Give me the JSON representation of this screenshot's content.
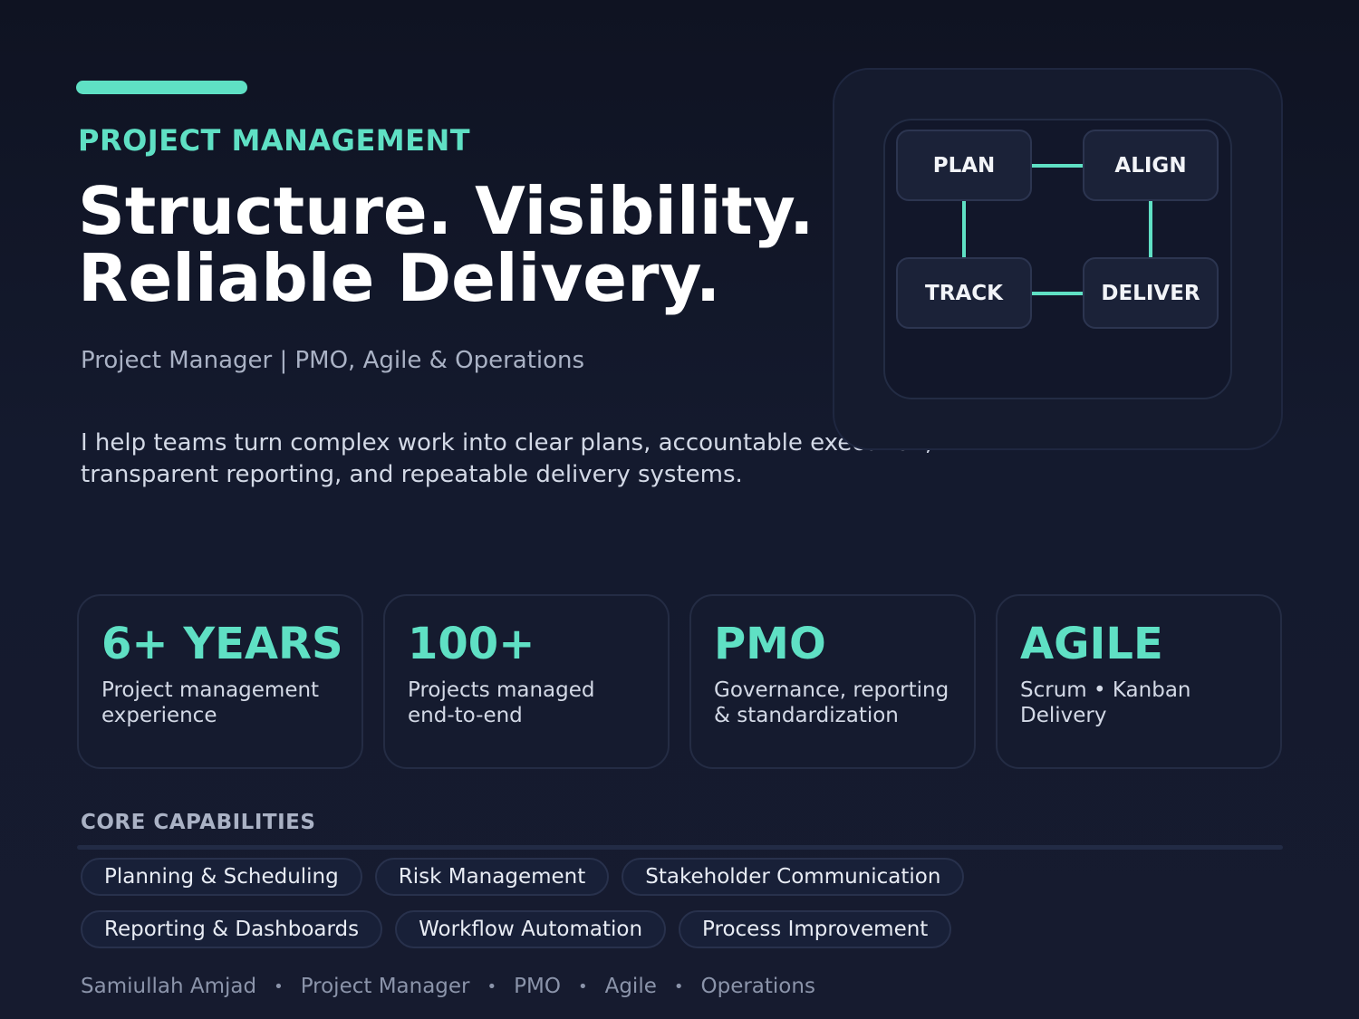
{
  "hero": {
    "eyebrow": "PROJECT MANAGEMENT",
    "headline_line1": "Structure. Visibility.",
    "headline_line2": "Reliable Delivery.",
    "subtitle": "Project Manager | PMO, Agile & Operations",
    "intro_line1": "I help teams turn complex work into clear plans, accountable execution,",
    "intro_line2": "transparent reporting, and repeatable delivery systems."
  },
  "flow": {
    "nodes": [
      "PLAN",
      "ALIGN",
      "TRACK",
      "DELIVER"
    ]
  },
  "stats": [
    {
      "value": "6+ YEARS",
      "line1": "Project management",
      "line2": "experience"
    },
    {
      "value": "100+",
      "line1": "Projects managed",
      "line2": "end-to-end"
    },
    {
      "value": "PMO",
      "line1": "Governance, reporting",
      "line2": "& standardization"
    },
    {
      "value": "AGILE",
      "line1": "Scrum • Kanban",
      "line2": "Delivery"
    }
  ],
  "capabilities": {
    "heading": "CORE CAPABILITIES",
    "row1": [
      "Planning & Scheduling",
      "Risk Management",
      "Stakeholder Communication"
    ],
    "row2": [
      "Reporting & Dashboards",
      "Workflow Automation",
      "Process Improvement"
    ]
  },
  "footer": {
    "items": [
      "Samiullah Amjad",
      "Project Manager",
      "PMO",
      "Agile",
      "Operations"
    ],
    "separator": "•"
  },
  "colors": {
    "accent": "#5fe0c4",
    "background": "#0f1322",
    "card": "#151b2f",
    "text_muted": "#aab2c5"
  }
}
